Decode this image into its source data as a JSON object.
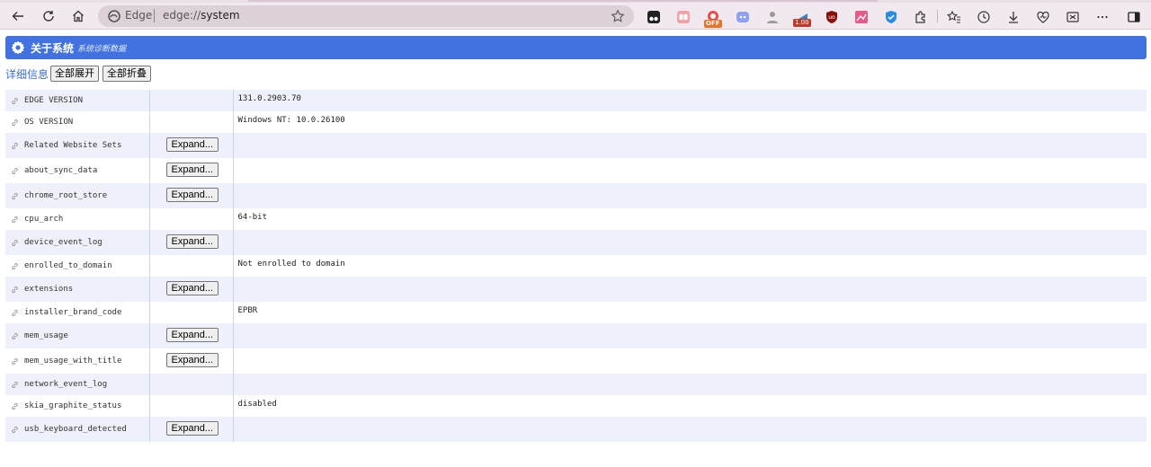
{
  "browser": {
    "brand": "Edge",
    "url_prefix": "edge://",
    "url_path": "system",
    "extension_badges": {
      "off": "OFF",
      "rate": "1.00"
    }
  },
  "page": {
    "title": "关于系统",
    "subtitle": "系统诊断数据",
    "details_label": "详细信息",
    "expand_all": "全部展开",
    "collapse_all": "全部折叠",
    "expand_label": "Expand..."
  },
  "rows": [
    {
      "name": "EDGE VERSION",
      "value": "131.0.2903.70",
      "expandable": false
    },
    {
      "name": "OS VERSION",
      "value": "Windows NT: 10.0.26100",
      "expandable": false
    },
    {
      "name": "Related Website Sets",
      "value": "",
      "expandable": true
    },
    {
      "name": "about_sync_data",
      "value": "",
      "expandable": true
    },
    {
      "name": "chrome_root_store",
      "value": "",
      "expandable": true
    },
    {
      "name": "cpu_arch",
      "value": "64-bit",
      "expandable": false
    },
    {
      "name": "device_event_log",
      "value": "",
      "expandable": true
    },
    {
      "name": "enrolled_to_domain",
      "value": "Not enrolled to domain",
      "expandable": false
    },
    {
      "name": "extensions",
      "value": "",
      "expandable": true
    },
    {
      "name": "installer_brand_code",
      "value": "EPBR",
      "expandable": false
    },
    {
      "name": "mem_usage",
      "value": "",
      "expandable": true
    },
    {
      "name": "mem_usage_with_title",
      "value": "",
      "expandable": true
    },
    {
      "name": "network_event_log",
      "value": "",
      "expandable": false
    },
    {
      "name": "skia_graphite_status",
      "value": "disabled",
      "expandable": false
    },
    {
      "name": "usb_keyboard_detected",
      "value": "",
      "expandable": true
    }
  ],
  "colors": {
    "banner": "#4272e0",
    "row_alt": "#eef0fb",
    "link": "#3c6fd1",
    "toolbar": "#f1e9ef"
  }
}
